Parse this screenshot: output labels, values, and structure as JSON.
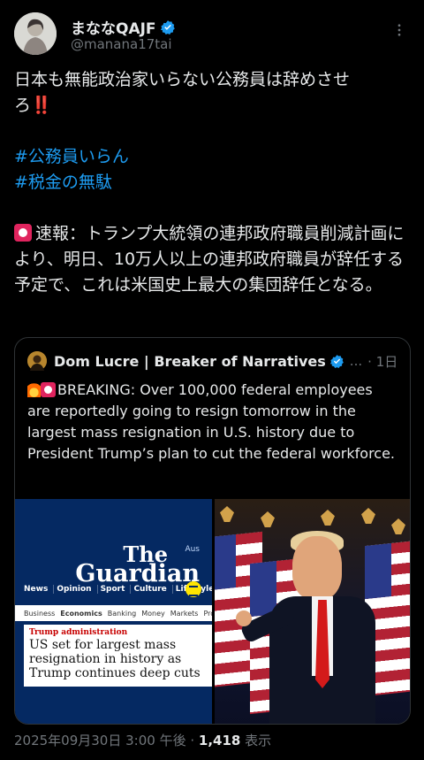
{
  "author": {
    "display_name": "まななQAJF",
    "handle": "@manana17tai",
    "verified_icon": "verified-badge-icon",
    "more_icon": "more-options-icon"
  },
  "tweet": {
    "line1": "日本も無能政治家いらない公務員は辞めさせ",
    "line2_prefix": "ろ",
    "line2_emoji": "‼️",
    "hashtags": [
      "#公務員いらん",
      "#税金の無駄"
    ],
    "news_label": "速報：トランプ大統領の連邦政府職員削減計画により、明日、10万人以上の連邦政府職員が辞任する予定で、これは米国史上最大の集団辞任となる。"
  },
  "quote": {
    "display_name": "Dom Lucre | Breaker of Narratives",
    "ellipsis": "...",
    "time": "· 1日",
    "text": "BREAKING: Over 100,000 federal employees are reportedly going to resign tomorrow in the largest mass resignation in U.S. history due to President Trump’s plan to cut the federal workforce.",
    "media_left": {
      "edition": "Aus",
      "brand_line1": "The",
      "brand_line2": "Guardian",
      "nav": [
        "News",
        "Opinion",
        "Sport",
        "Culture",
        "Lifestyle"
      ],
      "subnav": [
        "Business",
        "Economics",
        "Banking",
        "Money",
        "Markets",
        "Project"
      ],
      "kicker": "Trump administration",
      "headline": "US set for largest mass resignation in history as Trump continues deep cuts"
    }
  },
  "footer": {
    "timestamp": "2025年09月30日 3:00 午後",
    "separator": "·",
    "views_count": "1,418",
    "views_label": "表示"
  },
  "colors": {
    "background": "#000000",
    "text": "#e7e9ea",
    "muted": "#71767b",
    "link": "#1d9bf0",
    "border": "#2f3336",
    "guardian_blue": "#052962"
  }
}
